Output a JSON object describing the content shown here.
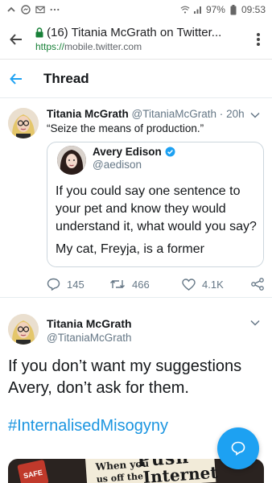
{
  "status_bar": {
    "time": "09:53",
    "battery": "97%",
    "icons": [
      "chevron-up-icon",
      "messenger-icon",
      "gmail-icon",
      "more-icon",
      "wifi-icon",
      "signal-icon",
      "battery-icon"
    ]
  },
  "browser": {
    "title": "(16) Titania McGrath on Twitter...",
    "url_scheme": "https://",
    "url_host": "mobile.twitter.com"
  },
  "header": {
    "title": "Thread"
  },
  "tweet1": {
    "name": "Titania McGrath",
    "handle": "@TitaniaMcGrath",
    "separator": "·",
    "time": "20h",
    "text": "“Seize the means of production.”",
    "quote": {
      "name": "Avery Edison",
      "handle": "@aedison",
      "verified": true,
      "text1": "If you could say one sentence to your pet and know they would understand it, what would you say?",
      "text2": "My cat, Freyja, is a former feral/stray"
    },
    "replies": "145",
    "retweets": "466",
    "likes": "4.1K"
  },
  "tweet2": {
    "name": "Titania McGrath",
    "handle": "@TitaniaMcGrath",
    "text": "If you don’t want my suggestions Avery, don’t ask for them.",
    "hashtag": "#InternalisedMisogyny",
    "media_text": {
      "left": "SAFE",
      "line1": "When you",
      "line2": "us off the",
      "push": "Push",
      "internet": "Internet"
    }
  },
  "colors": {
    "accent": "#1da1f2",
    "hashtag": "#1b95e0",
    "secondary_text": "#657786",
    "secure_green": "#188038"
  }
}
